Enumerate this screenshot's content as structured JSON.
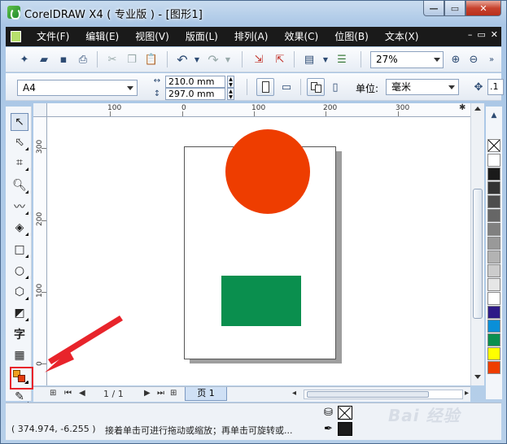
{
  "window": {
    "title": "CorelDRAW X4 ( 专业版 ) - [图形1]",
    "caption_minimize": "—",
    "caption_maximize": "▭",
    "caption_close": "✕"
  },
  "menu": {
    "items": [
      {
        "label": "文件(F)"
      },
      {
        "label": "编辑(E)"
      },
      {
        "label": "视图(V)"
      },
      {
        "label": "版面(L)"
      },
      {
        "label": "排列(A)"
      },
      {
        "label": "效果(C)"
      },
      {
        "label": "位图(B)"
      },
      {
        "label": "文本(X)"
      }
    ],
    "doc_controls": [
      "–",
      "▭",
      "✕"
    ]
  },
  "toolbar": {
    "zoom_value": "27%",
    "icons": [
      "new-icon",
      "open-icon",
      "save-icon",
      "print-icon",
      "cut-icon",
      "copy-icon",
      "paste-icon",
      "undo-icon",
      "redo-icon",
      "import-icon",
      "export-icon",
      "app-launcher-icon",
      "welcome-icon",
      "zoom-in-icon",
      "zoom-out-icon"
    ]
  },
  "property_bar": {
    "page_size": "A4",
    "width": "210.0 mm",
    "height": "297.0 mm",
    "unit_label": "单位:",
    "unit_value": "毫米",
    "nudge_value": ".1"
  },
  "rulers": {
    "top_labels": [
      "100",
      "0",
      "100",
      "200",
      "300"
    ],
    "left_labels": [
      "300",
      "200",
      "100",
      "0"
    ],
    "unit": "毫米"
  },
  "canvas": {
    "shapes": [
      {
        "type": "ellipse",
        "fill": "#ee3d00"
      },
      {
        "type": "rectangle",
        "fill": "#0a8f4e"
      }
    ]
  },
  "palette": {
    "colors": [
      "#ffffff",
      "#1a1a1a",
      "#333333",
      "#4d4d4d",
      "#666666",
      "#808080",
      "#999999",
      "#b3b3b3",
      "#cccccc",
      "#e6e6e6",
      "#ffffff",
      "#2e1a87",
      "#0a8fd8",
      "#0a8f4e",
      "#ffff00",
      "#ee3d00"
    ]
  },
  "page_nav": {
    "page_counter": "1 / 1",
    "page_tab": "页 1"
  },
  "status": {
    "coordinates": "( 374.974, -6.255 )",
    "hint": "接着单击可进行拖动或缩放；再单击可旋转或...",
    "watermark": "Bai 经验"
  }
}
